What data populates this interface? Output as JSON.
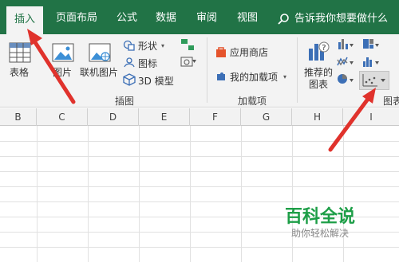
{
  "tabs": [
    {
      "label": "插入",
      "active": true
    },
    {
      "label": "页面布局",
      "active": false
    },
    {
      "label": "公式",
      "active": false
    },
    {
      "label": "数据",
      "active": false
    },
    {
      "label": "审阅",
      "active": false
    },
    {
      "label": "视图",
      "active": false
    }
  ],
  "tell_me": {
    "text": "告诉我你想要做什么",
    "icon": "search-icon"
  },
  "ribbon": {
    "table_label": "表格",
    "picture_label": "图片",
    "online_picture_label": "联机图片",
    "shapes_label": "形状",
    "icons_label": "图标",
    "model3d_label": "3D 模型",
    "illustrations_group": "插图",
    "store_label": "应用商店",
    "my_addins_label": "我的加载项",
    "addins_group": "加载项",
    "recommended_charts_label": "推荐的\n图表",
    "recommended_line1": "推荐的",
    "recommended_line2": "图表",
    "charts_group": "图表",
    "scatter_chart_button": "scatter-chart-icon"
  },
  "columns": [
    "B",
    "C",
    "D",
    "E",
    "F",
    "G",
    "H",
    "I"
  ],
  "watermark": {
    "title": "百科全说",
    "subtitle": "助你轻松解决"
  },
  "colors": {
    "accent": "#217346",
    "arrow": "#e0322c",
    "watermark": "#1d9e47"
  }
}
